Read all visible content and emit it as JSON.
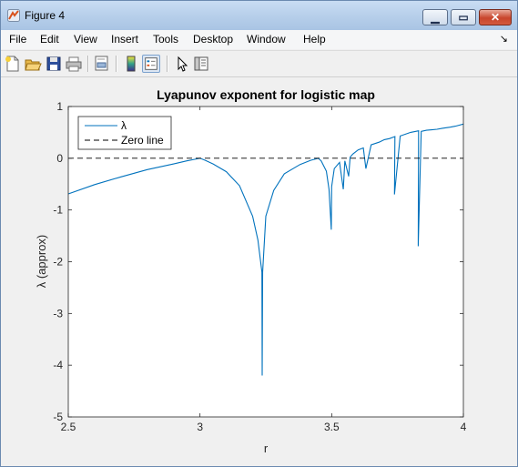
{
  "window": {
    "title": "Figure 4"
  },
  "menu": {
    "items": [
      "File",
      "Edit",
      "View",
      "Insert",
      "Tools",
      "Desktop",
      "Window",
      "Help"
    ],
    "overflow_arrow": "↘"
  },
  "toolbar": {
    "buttons": [
      "new-figure-icon",
      "open-file-icon",
      "save-icon",
      "print-icon",
      "print-preview-icon",
      "colorbar-icon",
      "legend-icon",
      "pointer-icon",
      "property-editor-icon"
    ]
  },
  "colors": {
    "line": "#0072bd",
    "zero_line": "#000000",
    "axes_bg": "#ffffff",
    "figure_bg": "#f0f0f0"
  },
  "chart_data": {
    "type": "line",
    "title": "Lyapunov exponent for logistic map",
    "xlabel": "r",
    "ylabel": "λ (approx)",
    "xlim": [
      2.5,
      4
    ],
    "ylim": [
      -5,
      1
    ],
    "xticks": [
      "2.5",
      "3",
      "3.5",
      "4"
    ],
    "yticks": [
      "1",
      "0",
      "-1",
      "-2",
      "-3",
      "-4",
      "-5"
    ],
    "grid": false,
    "legend": {
      "placement": "top-left",
      "entries": [
        "λ",
        "Zero line"
      ]
    },
    "series": [
      {
        "name": "λ",
        "style": "solid",
        "color": "#0072bd",
        "x": [
          2.5,
          2.6,
          2.7,
          2.8,
          2.9,
          2.95,
          2.98,
          3.0,
          3.02,
          3.05,
          3.1,
          3.15,
          3.2,
          3.22,
          3.235,
          3.2361,
          3.238,
          3.25,
          3.28,
          3.32,
          3.38,
          3.42,
          3.449,
          3.46,
          3.48,
          3.49,
          3.4985,
          3.5,
          3.51,
          3.53,
          3.544,
          3.55,
          3.5644,
          3.57,
          3.58,
          3.6,
          3.62,
          3.63,
          3.65,
          3.68,
          3.7,
          3.72,
          3.74,
          3.7385,
          3.76,
          3.8,
          3.83,
          3.8284,
          3.84,
          3.86,
          3.88,
          3.9,
          3.92,
          3.95,
          3.97,
          4.0
        ],
        "y": [
          -0.69,
          -0.51,
          -0.36,
          -0.22,
          -0.11,
          -0.05,
          -0.02,
          0,
          -0.04,
          -0.11,
          -0.26,
          -0.53,
          -1.12,
          -1.58,
          -2.2,
          -4.2,
          -2.2,
          -1.12,
          -0.62,
          -0.3,
          -0.12,
          -0.04,
          0,
          -0.05,
          -0.25,
          -0.6,
          -1.38,
          -0.55,
          -0.2,
          -0.08,
          -0.6,
          -0.05,
          -0.35,
          0.02,
          0.08,
          0.16,
          0.2,
          -0.2,
          0.26,
          0.31,
          0.36,
          0.38,
          0.42,
          -0.7,
          0.43,
          0.5,
          0.53,
          -1.7,
          0.52,
          0.54,
          0.55,
          0.56,
          0.58,
          0.6,
          0.62,
          0.66
        ]
      },
      {
        "name": "Zero line",
        "style": "dashed",
        "color": "#000000",
        "x": [
          2.5,
          4.0
        ],
        "y": [
          0,
          0
        ]
      }
    ]
  }
}
